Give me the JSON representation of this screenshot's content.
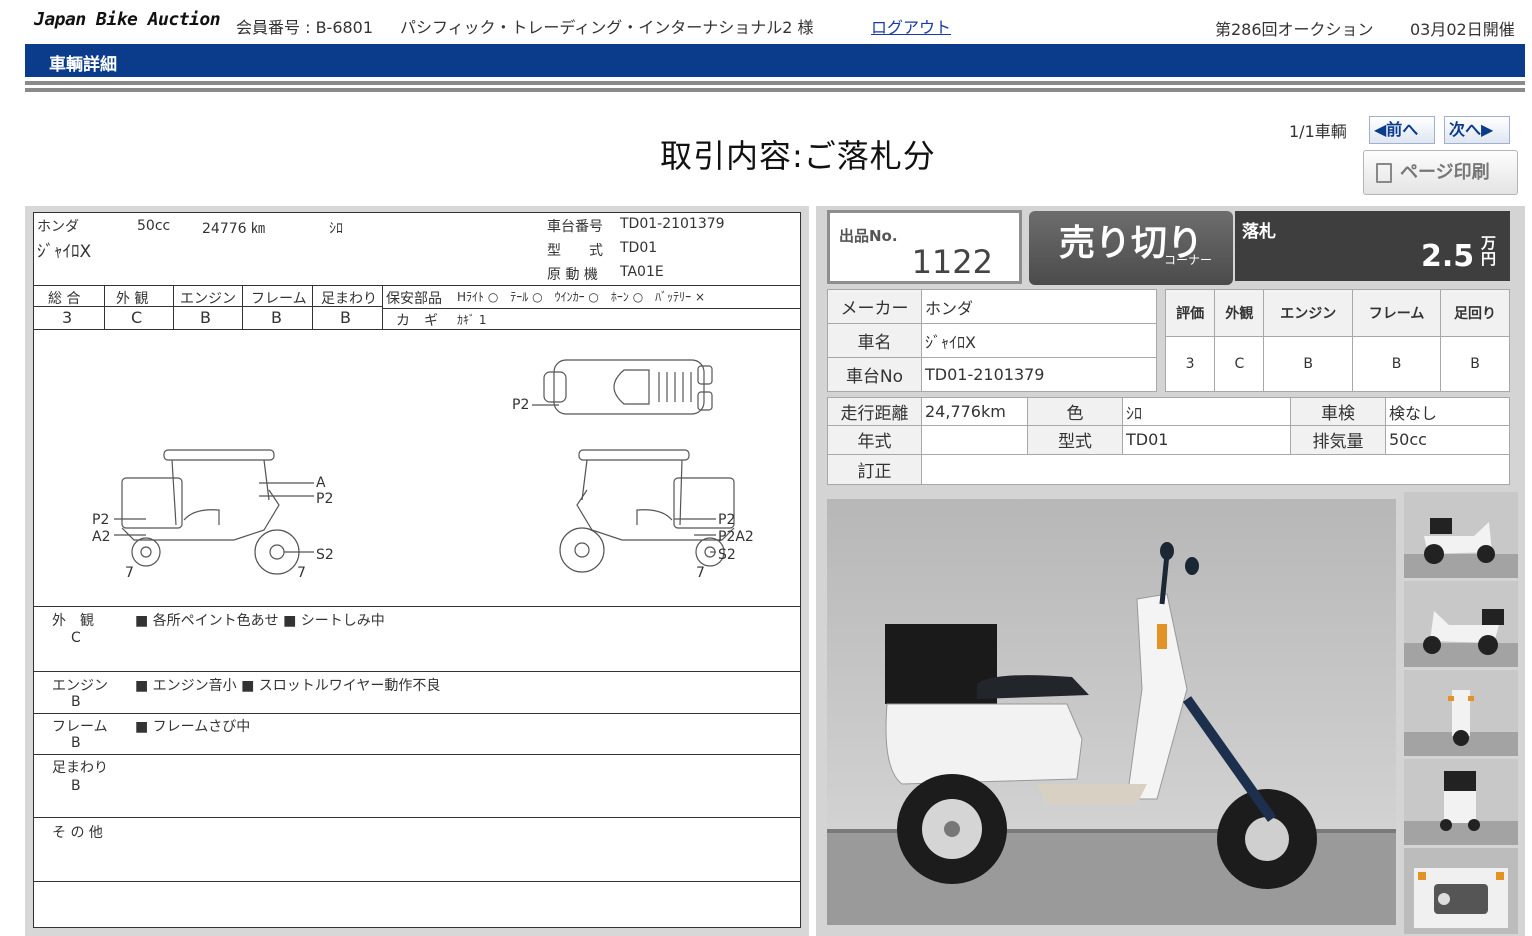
{
  "header": {
    "logo": "Japan Bike Auction",
    "member_label": "会員番号 : B-6801",
    "member_name": "パシフィック・トレーディング・インターナショナル2 様",
    "logout": "ログアウト",
    "auction_round": "第286回オークション",
    "auction_date": "03月02日開催"
  },
  "section_title": "車輌詳細",
  "page_title": "取引内容:ご落札分",
  "nav": {
    "count": "1/1車輌",
    "prev": "◀前へ",
    "next": "次へ▶",
    "print": "ページ印刷"
  },
  "sheet": {
    "maker": "ホンダ",
    "cc": "50cc",
    "mileage": "24776 ㎞",
    "color": "ｼﾛ",
    "model_name": "ｼﾞｬｲﾛX",
    "frame_no_label": "車台番号",
    "frame_no": "TD01-2101379",
    "type_label": "型　　式",
    "type": "TD01",
    "engine_label": "原 動 機",
    "engine": "TA01E",
    "grade_headers": [
      "総 合",
      "外 観",
      "エンジン",
      "フレーム",
      "足まわり"
    ],
    "grade_values": [
      "3",
      "C",
      "B",
      "B",
      "B"
    ],
    "safety_label": "保安部品",
    "safety_items": "Hﾗｲﾄ ○　ﾃｰﾙ ○　ｳｲﾝｶｰ ○　ﾎｰﾝ ○　ﾊﾞｯﾃﾘｰ ×",
    "key_label": "カ　ギ",
    "key_value": "ｶｷﾞ 1",
    "diagram_labels": {
      "top_p2": "P2",
      "left_p2": "P2",
      "left_a2": "A2",
      "left_a": "A",
      "left_p2b": "P2",
      "left_s2": "S2",
      "left_w1": "7",
      "left_w2": "7",
      "right_p2": "P2",
      "right_p2a2": "P2A2",
      "right_s2": "S2",
      "right_w": "7"
    },
    "remarks": [
      {
        "label": "外　観",
        "grade": "C",
        "text": "■ 各所ペイント色あせ ■ シートしみ中"
      },
      {
        "label": "エンジン",
        "grade": "B",
        "text": "■ エンジン音小 ■ スロットルワイヤー動作不良"
      },
      {
        "label": "フレーム",
        "grade": "B",
        "text": "■ フレームさび中"
      },
      {
        "label": "足まわり",
        "grade": "B",
        "text": ""
      },
      {
        "label": "そ の 他",
        "grade": "",
        "text": ""
      }
    ]
  },
  "lot": {
    "label": "出品No.",
    "number": "1122",
    "sold_label": "売り切り",
    "sold_sub": "コーナー",
    "bid_label": "落札",
    "bid_value": "2.5",
    "bid_unit": "万円"
  },
  "info": {
    "maker_label": "メーカー",
    "maker": "ホンダ",
    "name_label": "車名",
    "name": "ｼﾞｬｲﾛX",
    "frame_label": "車台No",
    "frame": "TD01-2101379",
    "grade_headers": [
      "評価",
      "外観",
      "エンジン",
      "フレーム",
      "足回り"
    ],
    "grade_values": [
      "3",
      "C",
      "B",
      "B",
      "B"
    ],
    "mileage_label": "走行距離",
    "mileage": "24,776km",
    "color_label": "色",
    "color": "ｼﾛ",
    "inspection_label": "車検",
    "inspection": "検なし",
    "year_label": "年式",
    "year": "",
    "type_label": "型式",
    "type": "TD01",
    "displacement_label": "排気量",
    "displacement": "50cc",
    "correction_label": "訂正",
    "correction": ""
  },
  "colors": {
    "brand_blue": "#0b3c8c",
    "bid_bg": "#3e3e3e"
  }
}
